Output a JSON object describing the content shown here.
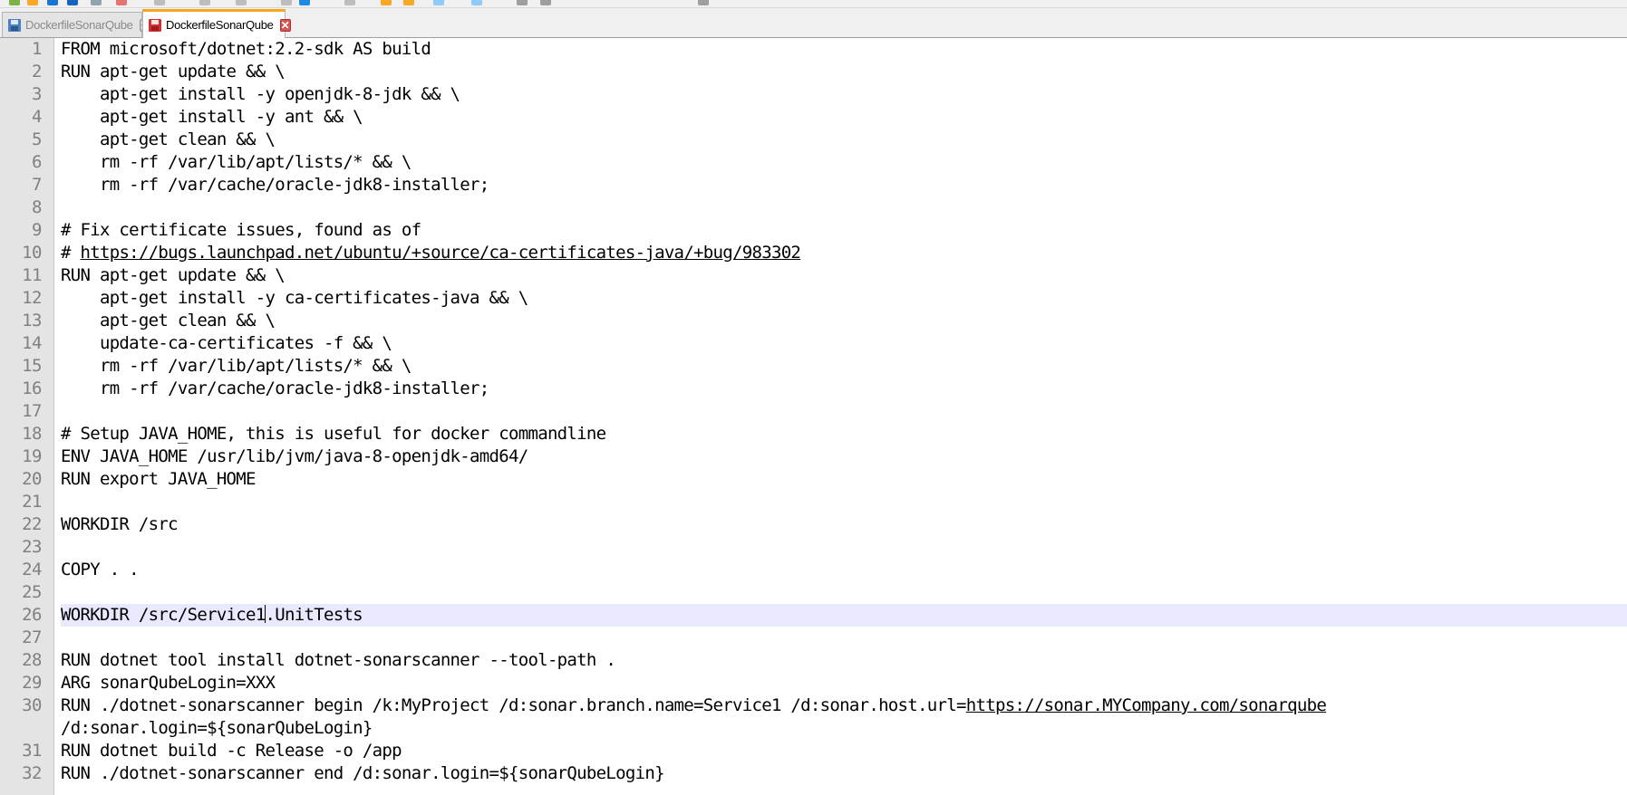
{
  "tabs": [
    {
      "label": "DockerfileSonarQube",
      "state": "inactive",
      "icon": "saved-file-icon"
    },
    {
      "label": "DockerfileSonarQube",
      "state": "active",
      "icon": "modified-file-icon"
    }
  ],
  "close_glyph": "✕",
  "colors": {
    "accent_tab": "#f5a623",
    "current_line": "#e8e8ff",
    "gutter": "#e4e4e4",
    "close_active": "#d9534f"
  },
  "lines": [
    {
      "num": "1",
      "segments": [
        {
          "t": "FROM microsoft/dotnet:2.2-sdk AS build"
        }
      ]
    },
    {
      "num": "2",
      "segments": [
        {
          "t": "RUN apt-get update && \\"
        }
      ]
    },
    {
      "num": "3",
      "segments": [
        {
          "t": "    apt-get install -y openjdk-8-jdk && \\"
        }
      ]
    },
    {
      "num": "4",
      "segments": [
        {
          "t": "    apt-get install -y ant && \\"
        }
      ]
    },
    {
      "num": "5",
      "segments": [
        {
          "t": "    apt-get clean && \\"
        }
      ]
    },
    {
      "num": "6",
      "segments": [
        {
          "t": "    rm -rf /var/lib/apt/lists/* && \\"
        }
      ]
    },
    {
      "num": "7",
      "segments": [
        {
          "t": "    rm -rf /var/cache/oracle-jdk8-installer;"
        }
      ]
    },
    {
      "num": "8",
      "segments": [
        {
          "t": ""
        }
      ]
    },
    {
      "num": "9",
      "segments": [
        {
          "t": "# Fix certificate issues, found as of"
        }
      ]
    },
    {
      "num": "10",
      "segments": [
        {
          "t": "# "
        },
        {
          "t": "https://bugs.launchpad.net/ubuntu/+source/ca-certificates-java/+bug/983302",
          "link": true
        }
      ]
    },
    {
      "num": "11",
      "segments": [
        {
          "t": "RUN apt-get update && \\"
        }
      ]
    },
    {
      "num": "12",
      "segments": [
        {
          "t": "    apt-get install -y ca-certificates-java && \\"
        }
      ]
    },
    {
      "num": "13",
      "segments": [
        {
          "t": "    apt-get clean && \\"
        }
      ]
    },
    {
      "num": "14",
      "segments": [
        {
          "t": "    update-ca-certificates -f && \\"
        }
      ]
    },
    {
      "num": "15",
      "segments": [
        {
          "t": "    rm -rf /var/lib/apt/lists/* && \\"
        }
      ]
    },
    {
      "num": "16",
      "segments": [
        {
          "t": "    rm -rf /var/cache/oracle-jdk8-installer;"
        }
      ]
    },
    {
      "num": "17",
      "segments": [
        {
          "t": ""
        }
      ]
    },
    {
      "num": "18",
      "segments": [
        {
          "t": "# Setup JAVA_HOME, this is useful for docker commandline"
        }
      ]
    },
    {
      "num": "19",
      "segments": [
        {
          "t": "ENV JAVA_HOME /usr/lib/jvm/java-8-openjdk-amd64/"
        }
      ]
    },
    {
      "num": "20",
      "segments": [
        {
          "t": "RUN export JAVA_HOME"
        }
      ]
    },
    {
      "num": "21",
      "segments": [
        {
          "t": ""
        }
      ]
    },
    {
      "num": "22",
      "segments": [
        {
          "t": "WORKDIR /src"
        }
      ]
    },
    {
      "num": "23",
      "segments": [
        {
          "t": ""
        }
      ]
    },
    {
      "num": "24",
      "segments": [
        {
          "t": "COPY . ."
        }
      ]
    },
    {
      "num": "25",
      "segments": [
        {
          "t": ""
        }
      ]
    },
    {
      "num": "26",
      "current": true,
      "segments": [
        {
          "t": "WORKDIR /src/Service1"
        },
        {
          "caret": true
        },
        {
          "t": ".UnitTests"
        }
      ]
    },
    {
      "num": "27",
      "segments": [
        {
          "t": ""
        }
      ]
    },
    {
      "num": "28",
      "segments": [
        {
          "t": "RUN dotnet tool install dotnet-sonarscanner --tool-path ."
        }
      ]
    },
    {
      "num": "29",
      "segments": [
        {
          "t": "ARG sonarQubeLogin=XXX"
        }
      ]
    },
    {
      "num": "30",
      "wrap": true,
      "segments": [
        {
          "t": "RUN ./dotnet-sonarscanner begin /k:MyProject /d:sonar.branch.name=Service1 /d:sonar.host.url="
        },
        {
          "t": "https://sonar.MYCompany.com/sonarqube",
          "link": true
        },
        {
          "br": true
        },
        {
          "t": "/d:sonar.login=${sonarQubeLogin}"
        }
      ]
    },
    {
      "num": "31",
      "segments": [
        {
          "t": "RUN dotnet build -c Release -o /app"
        }
      ]
    },
    {
      "num": "32",
      "segments": [
        {
          "t": "RUN ./dotnet-sonarscanner end /d:sonar.login=${sonarQubeLogin}"
        }
      ]
    }
  ]
}
